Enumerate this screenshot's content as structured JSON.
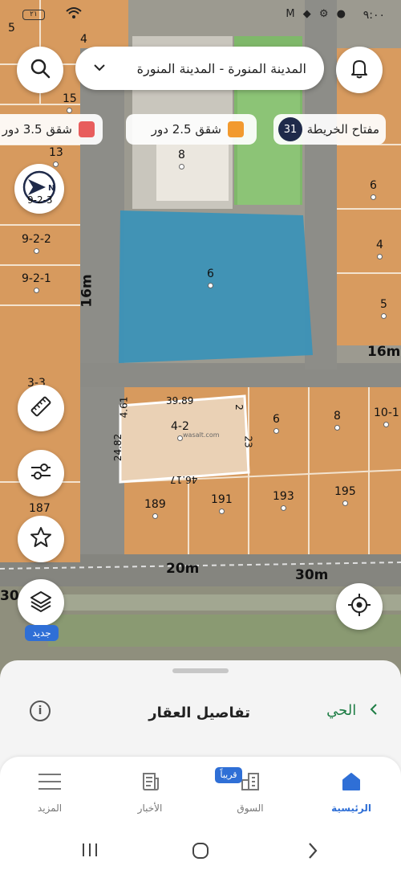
{
  "status_bar": {
    "time": "٩:٠٠",
    "icons": "M ◆ ⚙ ●",
    "battery": "٢١",
    "wifi": "wifi-icon"
  },
  "top": {
    "city_select": "المدينة المنورة - المدينة المنورة",
    "map_key_label": "مفتاح الخريطة",
    "map_key_count": "31",
    "legend": [
      {
        "label": "شقق 2.5 دور",
        "color": "#f29a2e"
      },
      {
        "label": "شقق 3.5 دور",
        "color": "#e85d5d"
      }
    ]
  },
  "map": {
    "parcels": [
      "5",
      "4",
      "15",
      "13",
      "8",
      "6",
      "9-2-2",
      "9-2-1",
      "6",
      "4",
      "5",
      "3-3",
      "187",
      "4-2",
      "6",
      "8",
      "10-1",
      "189",
      "191",
      "193",
      "195",
      "9-2-3"
    ],
    "roads": [
      "16m",
      "16m",
      "20m",
      "30m",
      "30m"
    ],
    "dimensions": [
      "39.89",
      "4.61",
      "2",
      "24.82",
      "23",
      "46.17"
    ],
    "watermark": "wasalt.com"
  },
  "side_buttons": {
    "new_tag": "جديد"
  },
  "sheet": {
    "title": "تفاصيل العقار",
    "district": "الحي"
  },
  "tabs": [
    {
      "label": "الرئيسية",
      "active": true
    },
    {
      "label": "السوق",
      "active": false,
      "badge": "قريباً"
    },
    {
      "label": "الأخبار",
      "active": false
    },
    {
      "label": "المزيد",
      "active": false
    }
  ],
  "colors": {
    "accent": "#2f6fd6",
    "district_green": "#1e7d45",
    "parcel_orange": "#e0a86a",
    "highlight_blue": "#3a93b8"
  }
}
